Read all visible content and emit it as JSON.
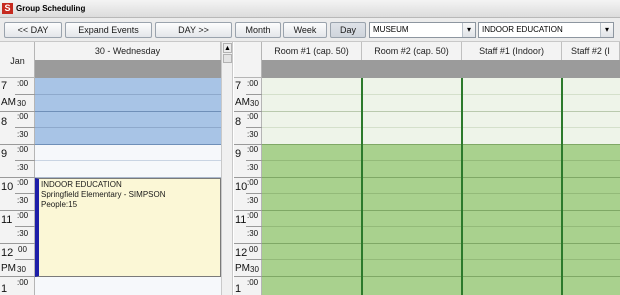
{
  "window": {
    "title": "Group Scheduling",
    "app_icon": "S"
  },
  "toolbar": {
    "prev_day": "<< DAY",
    "expand_events": "Expand Events",
    "next_day": "DAY >>",
    "month": "Month",
    "week": "Week",
    "day": "Day",
    "location_select": "MUSEUM",
    "program_select": "INDOOR EDUCATION"
  },
  "calendar": {
    "month_label": "Jan",
    "day_header": "30 - Wednesday",
    "times": [
      {
        "hour": "7",
        "top": ":00",
        "bottom": ""
      },
      {
        "hour": "AM",
        "top": "",
        "bottom": "30"
      },
      {
        "hour": "8",
        "top": ":00",
        "bottom": ":30"
      },
      {
        "hour": "9",
        "top": ":00",
        "bottom": ":30"
      },
      {
        "hour": "10",
        "top": ":00",
        "bottom": ":30"
      },
      {
        "hour": "11",
        "top": ":00",
        "bottom": ":30"
      },
      {
        "hour": "12",
        "top": "00",
        "bottom": ""
      },
      {
        "hour": "PM",
        "top": "",
        "bottom": "30"
      },
      {
        "hour": "1",
        "top": ":00",
        "bottom": ""
      }
    ],
    "event": {
      "title": "INDOOR EDUCATION",
      "school": "Springfield Elementary - SIMPSON",
      "people": "People:15"
    }
  },
  "resources": {
    "columns": [
      "Room #1 (cap. 50)",
      "Room #2 (cap. 50)",
      "Staff #1 (Indoor)",
      "Staff #2 (I"
    ]
  },
  "colors": {
    "booked_blue": "#a8c4e6",
    "free_light": "#f6f8fb",
    "available_green_light": "#eef4e9",
    "available_green": "#a9d18e",
    "event_bg": "#fbf7d6",
    "event_border": "#1d1ea8"
  }
}
